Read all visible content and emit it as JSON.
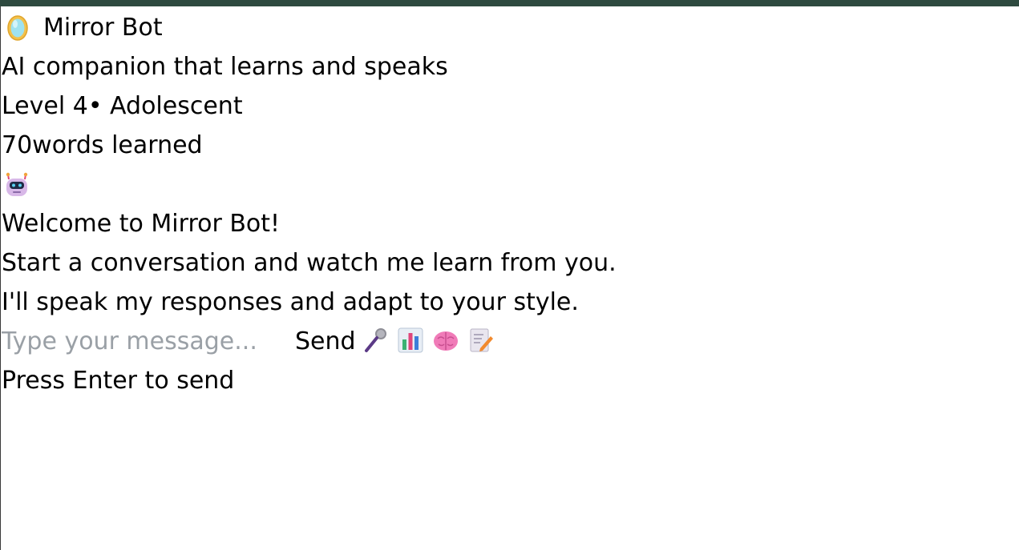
{
  "header": {
    "logo_icon": "mirror-icon",
    "title": "Mirror Bot",
    "subtitle": "AI companion that learns and speaks"
  },
  "stats": {
    "level_text": "Level 4• Adolescent",
    "words_text": "70words learned"
  },
  "welcome": {
    "avatar_icon": "robot-icon",
    "heading": "Welcome to Mirror Bot!",
    "line1": "Start a conversation and watch me learn from you.",
    "line2": "I'll speak my responses and adapt to your style."
  },
  "composer": {
    "placeholder": "Type your message...",
    "value": "",
    "send_label": "Send",
    "tools": [
      "microphone-icon",
      "chart-icon",
      "brain-icon",
      "memo-icon"
    ],
    "hint": "Press Enter to send"
  },
  "colors": {
    "top_strip": "#2e4a3f",
    "placeholder": "#9aa0a6"
  }
}
